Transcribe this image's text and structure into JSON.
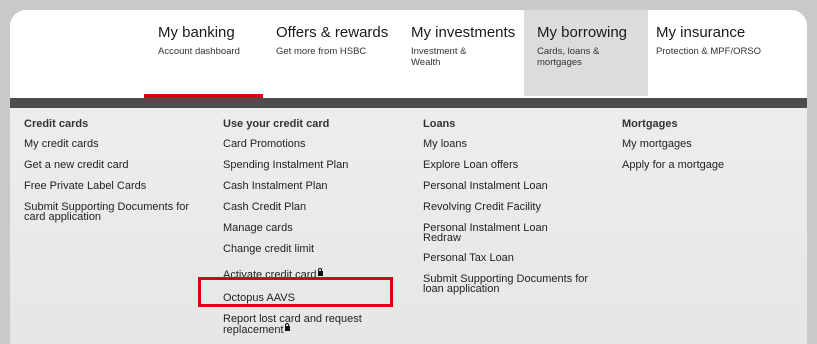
{
  "nav": {
    "items": [
      {
        "title": "My banking",
        "sub": "Account dashboard"
      },
      {
        "title": "Offers & rewards",
        "sub": "Get more from HSBC"
      },
      {
        "title": "My investments",
        "sub": "Investment & Wealth"
      },
      {
        "title": "My borrowing",
        "sub": "Cards, loans & mortgages"
      },
      {
        "title": "My insurance",
        "sub": "Protection & MPF/ORSO"
      }
    ],
    "accent_color": "#db0011",
    "selected_bg": "#dcdcdc"
  },
  "menu": {
    "credit_cards": {
      "heading": "Credit cards",
      "links": [
        "My credit cards",
        "Get a new credit card",
        "Free Private Label Cards",
        "Submit Supporting Documents for card application"
      ]
    },
    "use_card": {
      "heading": "Use your credit card",
      "links": [
        "Card Promotions",
        "Spending Instalment Plan",
        "Cash Instalment Plan",
        "Cash Credit Plan",
        "Manage cards",
        "Change credit limit",
        "Activate credit card",
        "Octopus AAVS",
        "Report lost card and request replacement"
      ]
    },
    "loans": {
      "heading": "Loans",
      "links": [
        "My loans",
        "Explore Loan offers",
        "Personal Instalment Loan",
        "Revolving Credit Facility",
        "Personal Instalment Loan Redraw",
        "Personal Tax Loan",
        "Submit Supporting Documents for loan application"
      ]
    },
    "mortgages": {
      "heading": "Mortgages",
      "links": [
        "My mortgages",
        "Apply for a mortgage"
      ]
    }
  }
}
